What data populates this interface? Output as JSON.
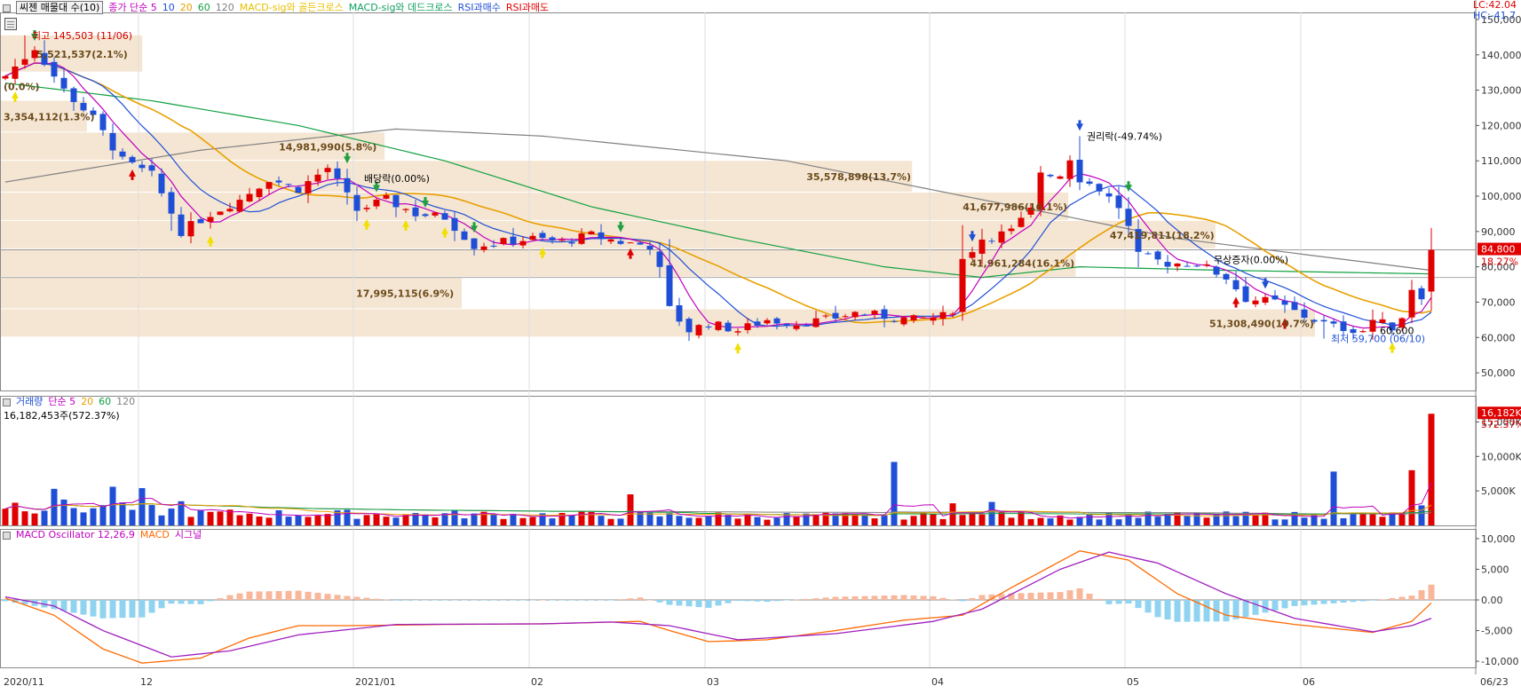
{
  "legends": {
    "price": [
      {
        "text": "씨젠 매물대 수(10)",
        "color": "#000000",
        "boxed": true
      },
      {
        "text": "종가 단순 5",
        "color": "#c000c0"
      },
      {
        "text": "10",
        "color": "#1f4fd6"
      },
      {
        "text": "20",
        "color": "#e8a000"
      },
      {
        "text": "60",
        "color": "#10a040"
      },
      {
        "text": "120",
        "color": "#808080"
      },
      {
        "text": "MACD-sig와 골든크로스",
        "color": "#e8c000"
      },
      {
        "text": "MACD-sig와 데드크로스",
        "color": "#10a060"
      },
      {
        "text": "RSI과매수",
        "color": "#1f4fd6"
      },
      {
        "text": "RSI과매도",
        "color": "#e00000"
      }
    ],
    "volume": [
      {
        "text": "거래량",
        "color": "#1f4fd6"
      },
      {
        "text": "단순 5",
        "color": "#c000c0"
      },
      {
        "text": "20",
        "color": "#e8a000"
      },
      {
        "text": "60",
        "color": "#10a040"
      },
      {
        "text": "120",
        "color": "#808080"
      }
    ],
    "volume_info": "16,182,453주(572.37%)",
    "macd": [
      {
        "text": "MACD Oscillator 12,26,9",
        "color": "#c000c0"
      },
      {
        "text": "MACD",
        "color": "#ff6a00"
      },
      {
        "text": "시그널",
        "color": "#c000c0"
      }
    ]
  },
  "corner": {
    "lc": "LC:42.04",
    "hc": "HC:-41.7"
  },
  "chart_data": [
    {
      "type": "candlestick",
      "title": "씨젠 매물대 수(10)",
      "ylim": [
        45000,
        152000
      ],
      "yticks": [
        50000,
        60000,
        70000,
        80000,
        90000,
        100000,
        110000,
        120000,
        130000,
        140000,
        150000
      ],
      "ytick_labels": [
        "50,000",
        "60,000",
        "70,000",
        "80,000",
        "90,000",
        "100,000",
        "110,000",
        "120,000",
        "130,000",
        "140,000",
        "150,000"
      ],
      "current_price_label": "84,800",
      "current_change_label": "18.27%",
      "current_price": 84800,
      "sessions": 147,
      "anchors": [
        {
          "i": 0,
          "c": 134000
        },
        {
          "i": 3,
          "c": 142000
        },
        {
          "i": 6,
          "c": 130000
        },
        {
          "i": 9,
          "c": 122000
        },
        {
          "i": 12,
          "c": 110000
        },
        {
          "i": 15,
          "c": 106000
        },
        {
          "i": 18,
          "c": 90000
        },
        {
          "i": 21,
          "c": 95000
        },
        {
          "i": 24,
          "c": 99000
        },
        {
          "i": 27,
          "c": 105000
        },
        {
          "i": 30,
          "c": 102000
        },
        {
          "i": 33,
          "c": 108000
        },
        {
          "i": 36,
          "c": 96000
        },
        {
          "i": 39,
          "c": 99000
        },
        {
          "i": 42,
          "c": 95000
        },
        {
          "i": 45,
          "c": 94000
        },
        {
          "i": 48,
          "c": 86000
        },
        {
          "i": 51,
          "c": 87000
        },
        {
          "i": 54,
          "c": 88000
        },
        {
          "i": 57,
          "c": 87000
        },
        {
          "i": 60,
          "c": 89000
        },
        {
          "i": 63,
          "c": 87000
        },
        {
          "i": 66,
          "c": 86000
        },
        {
          "i": 67,
          "c": 79000
        },
        {
          "i": 68,
          "c": 68000
        },
        {
          "i": 70,
          "c": 62000
        },
        {
          "i": 72,
          "c": 64000
        },
        {
          "i": 75,
          "c": 62000
        },
        {
          "i": 78,
          "c": 65000
        },
        {
          "i": 81,
          "c": 64000
        },
        {
          "i": 84,
          "c": 65000
        },
        {
          "i": 87,
          "c": 67000
        },
        {
          "i": 90,
          "c": 66000
        },
        {
          "i": 93,
          "c": 65000
        },
        {
          "i": 96,
          "c": 66000
        },
        {
          "i": 97,
          "c": 68000
        },
        {
          "i": 98,
          "c": 82000
        },
        {
          "i": 100,
          "c": 88000
        },
        {
          "i": 103,
          "c": 90000
        },
        {
          "i": 105,
          "c": 96000
        },
        {
          "i": 106,
          "c": 107000
        },
        {
          "i": 108,
          "c": 106000
        },
        {
          "i": 109,
          "c": 111000
        },
        {
          "i": 110,
          "c": 105000
        },
        {
          "i": 112,
          "c": 102000
        },
        {
          "i": 114,
          "c": 97000
        },
        {
          "i": 115,
          "c": 91000
        },
        {
          "i": 116,
          "c": 83000
        },
        {
          "i": 119,
          "c": 81000
        },
        {
          "i": 122,
          "c": 81000
        },
        {
          "i": 125,
          "c": 77000
        },
        {
          "i": 127,
          "c": 71000
        },
        {
          "i": 130,
          "c": 70000
        },
        {
          "i": 133,
          "c": 66000
        },
        {
          "i": 136,
          "c": 63000
        },
        {
          "i": 139,
          "c": 62000
        },
        {
          "i": 140,
          "c": 65000
        },
        {
          "i": 142,
          "c": 63000
        },
        {
          "i": 143,
          "c": 66000
        },
        {
          "i": 144,
          "c": 74000
        },
        {
          "i": 145,
          "c": 72000
        },
        {
          "i": 146,
          "c": 84800
        }
      ],
      "volume_profile": [
        {
          "low": 60000,
          "high": 68000,
          "value": 51308490,
          "label": "51,308,490(19.7%)"
        },
        {
          "low": 68000,
          "high": 77000,
          "value": 17995115,
          "label": "17,995,115(6.9%)"
        },
        {
          "low": 77000,
          "high": 85000,
          "value": 41961284,
          "label": "41,961,284(16.1%)"
        },
        {
          "low": 85000,
          "high": 93000,
          "value": 47419811,
          "label": "47,419,811(18.2%)"
        },
        {
          "low": 93000,
          "high": 101000,
          "value": 41677986,
          "label": "41,677,986(16.1%)"
        },
        {
          "low": 101000,
          "high": 110000,
          "value": 35578898,
          "label": "35,578,898(13.7%)"
        },
        {
          "low": 110000,
          "high": 118000,
          "value": 14981990,
          "label": "14,981,990(5.8%)"
        },
        {
          "low": 118000,
          "high": 127000,
          "value": 3354112,
          "label": "3,354,112(1.3%)"
        },
        {
          "low": 127000,
          "high": 135000,
          "value": 0,
          "label": "(0.0%)"
        },
        {
          "low": 135000,
          "high": 145503,
          "value": 5521537,
          "label": "5,521,537(2.1%)"
        }
      ],
      "annotations": [
        {
          "text": "최고 145,503 (11/06)",
          "color": "#d00000",
          "i": 2,
          "price": 145503
        },
        {
          "text": "최저 59,700 (06/10)",
          "color": "#1f4fd6",
          "i": 135,
          "price": 59700
        },
        {
          "text": "권리락(-49.74%)",
          "color": "#000000",
          "i": 110,
          "price": 117000
        },
        {
          "text": "배당락(0.00%)",
          "color": "#000000",
          "i": 36,
          "price": 105000
        },
        {
          "text": "무상증자(0.00%)",
          "color": "#000000",
          "i": 123,
          "price": 82000
        },
        {
          "text": "60,600",
          "color": "#000000",
          "i": 140,
          "price": 62000
        }
      ],
      "lines": [
        {
          "name": "MA120",
          "color": "#808080",
          "points": [
            [
              0,
              104000
            ],
            [
              20,
              113000
            ],
            [
              40,
              119000
            ],
            [
              55,
              117000
            ],
            [
              80,
              110000
            ],
            [
              100,
              99000
            ],
            [
              120,
              88000
            ],
            [
              146,
              79000
            ]
          ]
        },
        {
          "name": "MA60",
          "color": "#10a040",
          "points": [
            [
              0,
              132000
            ],
            [
              15,
              127000
            ],
            [
              30,
              120000
            ],
            [
              45,
              110000
            ],
            [
              60,
              97000
            ],
            [
              75,
              88000
            ],
            [
              90,
              80000
            ],
            [
              100,
              77000
            ],
            [
              110,
              80000
            ],
            [
              125,
              79000
            ],
            [
              146,
              78000
            ]
          ]
        }
      ],
      "signals": [
        {
          "i": 1,
          "kind": "golden"
        },
        {
          "i": 21,
          "kind": "golden"
        },
        {
          "i": 37,
          "kind": "golden"
        },
        {
          "i": 41,
          "kind": "golden"
        },
        {
          "i": 45,
          "kind": "golden"
        },
        {
          "i": 55,
          "kind": "golden"
        },
        {
          "i": 75,
          "kind": "golden"
        },
        {
          "i": 142,
          "kind": "golden"
        },
        {
          "i": 3,
          "kind": "dead"
        },
        {
          "i": 35,
          "kind": "dead"
        },
        {
          "i": 38,
          "kind": "dead"
        },
        {
          "i": 43,
          "kind": "dead"
        },
        {
          "i": 48,
          "kind": "dead"
        },
        {
          "i": 63,
          "kind": "dead"
        },
        {
          "i": 115,
          "kind": "dead"
        },
        {
          "i": 99,
          "kind": "rsi-buy"
        },
        {
          "i": 110,
          "kind": "rsi-buy"
        },
        {
          "i": 129,
          "kind": "rsi-buy"
        },
        {
          "i": 13,
          "kind": "rsi-sell"
        },
        {
          "i": 64,
          "kind": "rsi-sell"
        },
        {
          "i": 126,
          "kind": "rsi-sell"
        },
        {
          "i": 131,
          "kind": "rsi-sell"
        }
      ]
    },
    {
      "type": "bar",
      "title": "거래량",
      "ylim": [
        0,
        17500000
      ],
      "yticks": [
        5000000,
        10000000,
        15000000
      ],
      "ytick_labels": [
        "5,000K",
        "10,000K",
        "15,000K"
      ],
      "current_volume_label": "16,182K",
      "current_volume_change_label": "572.37%",
      "last_volume": 16182453,
      "spikes": [
        {
          "i": 5,
          "v": 5300000
        },
        {
          "i": 11,
          "v": 5600000
        },
        {
          "i": 14,
          "v": 5400000
        },
        {
          "i": 18,
          "v": 3500000
        },
        {
          "i": 64,
          "v": 4500000
        },
        {
          "i": 91,
          "v": 9200000
        },
        {
          "i": 97,
          "v": 3200000
        },
        {
          "i": 101,
          "v": 3400000
        },
        {
          "i": 136,
          "v": 7800000
        },
        {
          "i": 144,
          "v": 8000000
        },
        {
          "i": 145,
          "v": 2900000
        }
      ]
    },
    {
      "type": "bar+line",
      "title": "MACD Oscillator 12,26,9",
      "ylim": [
        -11000,
        11000
      ],
      "yticks": [
        -10000,
        -5000,
        0,
        5000,
        10000
      ],
      "ytick_labels": [
        "-10,000",
        "-5,000",
        "0.00",
        "5,000",
        "10,000"
      ],
      "macd": [
        [
          0,
          300
        ],
        [
          5,
          -2500
        ],
        [
          10,
          -8000
        ],
        [
          14,
          -10300
        ],
        [
          20,
          -9500
        ],
        [
          25,
          -6200
        ],
        [
          30,
          -4200
        ],
        [
          35,
          -4200
        ],
        [
          45,
          -4000
        ],
        [
          55,
          -3900
        ],
        [
          60,
          -3700
        ],
        [
          65,
          -3500
        ],
        [
          68,
          -5000
        ],
        [
          72,
          -6800
        ],
        [
          78,
          -6500
        ],
        [
          85,
          -5000
        ],
        [
          92,
          -3300
        ],
        [
          98,
          -2500
        ],
        [
          103,
          2000
        ],
        [
          110,
          8000
        ],
        [
          115,
          6500
        ],
        [
          120,
          1000
        ],
        [
          125,
          -2500
        ],
        [
          132,
          -4000
        ],
        [
          140,
          -5300
        ],
        [
          144,
          -3500
        ],
        [
          146,
          -500
        ]
      ],
      "signal": [
        [
          0,
          500
        ],
        [
          5,
          -1000
        ],
        [
          10,
          -5000
        ],
        [
          17,
          -9300
        ],
        [
          23,
          -8300
        ],
        [
          30,
          -5700
        ],
        [
          40,
          -4000
        ],
        [
          55,
          -3900
        ],
        [
          62,
          -3600
        ],
        [
          68,
          -4200
        ],
        [
          75,
          -6500
        ],
        [
          85,
          -5500
        ],
        [
          95,
          -3500
        ],
        [
          100,
          -1500
        ],
        [
          108,
          5000
        ],
        [
          113,
          7800
        ],
        [
          118,
          6000
        ],
        [
          125,
          1000
        ],
        [
          132,
          -3000
        ],
        [
          140,
          -5200
        ],
        [
          144,
          -4200
        ],
        [
          146,
          -3000
        ]
      ]
    }
  ],
  "x_axis": {
    "labels": [
      {
        "text": "2020/11",
        "i": 0
      },
      {
        "text": "12",
        "i": 14
      },
      {
        "text": "2021/01",
        "i": 36
      },
      {
        "text": "02",
        "i": 54
      },
      {
        "text": "03",
        "i": 72
      },
      {
        "text": "04",
        "i": 95
      },
      {
        "text": "05",
        "i": 115
      },
      {
        "text": "06",
        "i": 133
      },
      {
        "text": "06/23",
        "i": 146
      }
    ]
  }
}
